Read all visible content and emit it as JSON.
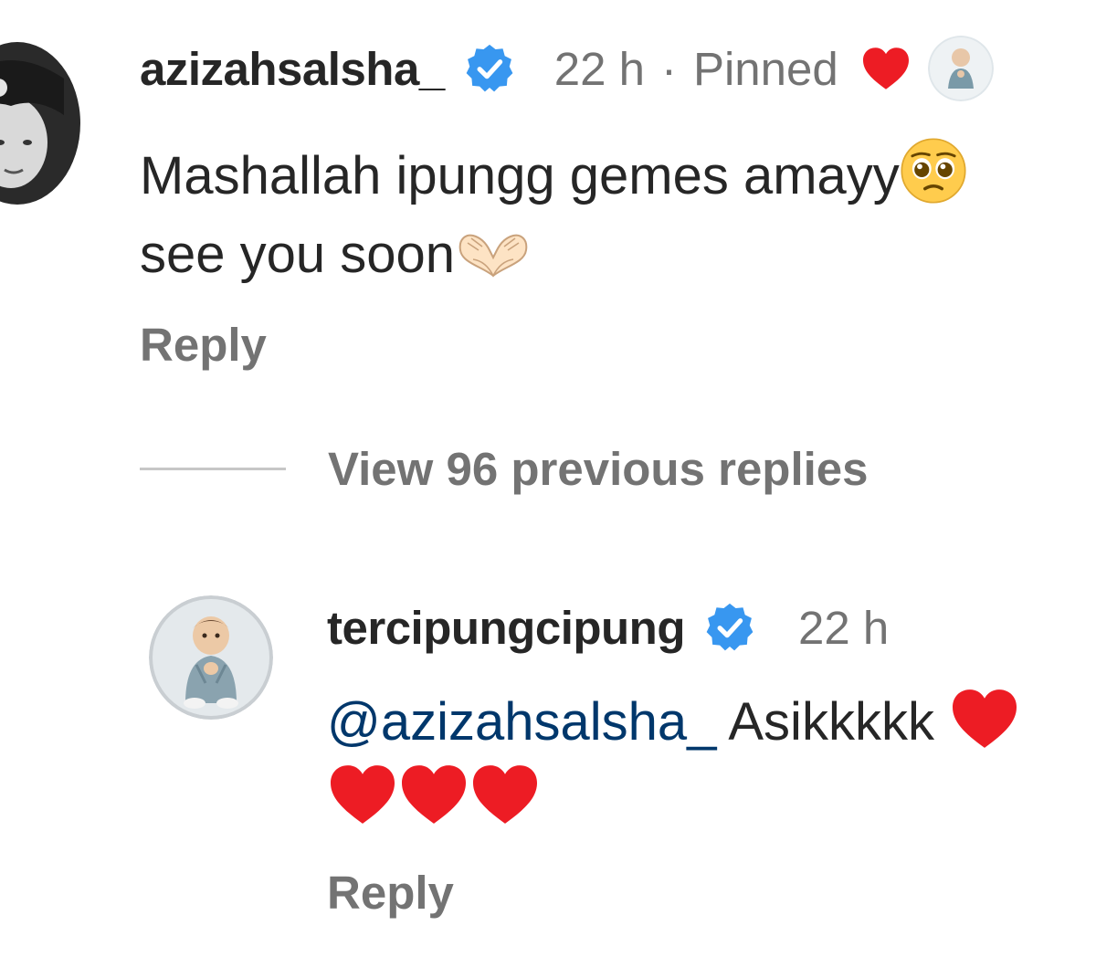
{
  "comment": {
    "username": "azizahsalsha_",
    "time": "22 h",
    "separator": "·",
    "pinned_label": "Pinned",
    "text_line1": "Mashallah ipungg gemes amayy",
    "text_line2": "see you soon",
    "reply_label": "Reply",
    "liked_by_author": true
  },
  "thread": {
    "view_replies_label": "View 96 previous replies"
  },
  "reply": {
    "username": "tercipungcipung",
    "time": "22 h",
    "mention": "@azizahsalsha_",
    "text": "Asikkkkk",
    "reply_label": "Reply"
  },
  "colors": {
    "verified_badge": "#3897f0",
    "heart": "#ed1c24",
    "secondary_text": "#737373",
    "mention": "#00376b"
  },
  "icons": {
    "verified": "verified-badge-icon",
    "heart": "heart-icon",
    "emoji_pleading": "pleading-face-emoji",
    "emoji_heart_hands": "heart-hands-emoji"
  }
}
